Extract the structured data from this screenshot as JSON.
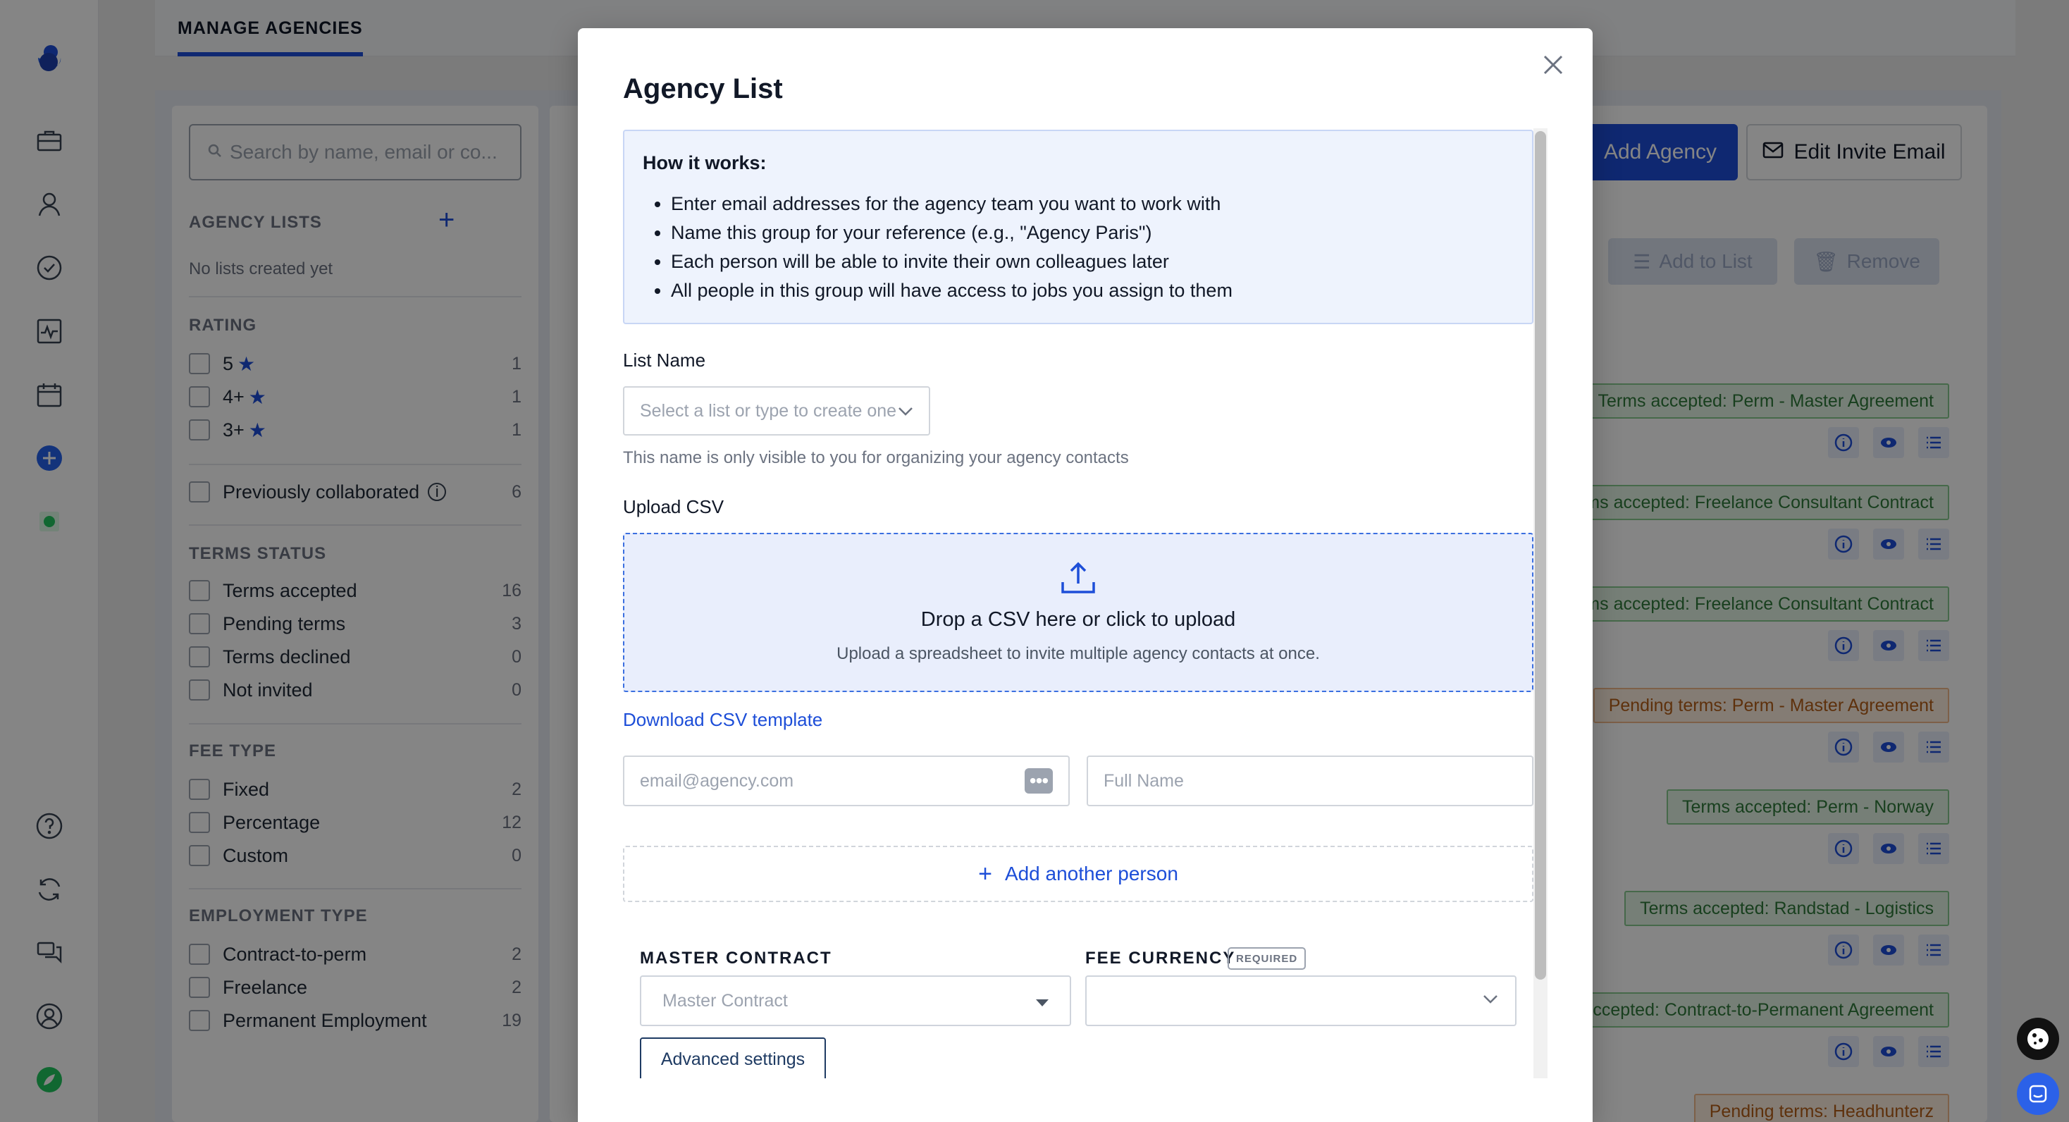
{
  "rail": {
    "icons": [
      "logo-icon",
      "briefcase-icon",
      "person-icon",
      "check-circle-icon",
      "activity-icon",
      "calendar-icon",
      "plus-circle-icon",
      "app-icon",
      "help-icon",
      "sync-icon",
      "chat-icon",
      "account-icon",
      "leaf-icon"
    ]
  },
  "background": {
    "tab_label": "MANAGE AGENCIES",
    "search_placeholder": "Search by name, email or co...",
    "agency_lists_heading": "AGENCY LISTS",
    "no_lists": "No lists created yet",
    "rating_heading": "RATING",
    "rating": [
      {
        "label": "5",
        "count": "1"
      },
      {
        "label": "4+",
        "count": "1"
      },
      {
        "label": "3+",
        "count": "1"
      }
    ],
    "previously_collaborated": {
      "label": "Previously collaborated",
      "count": "6"
    },
    "terms_heading": "TERMS STATUS",
    "terms": [
      {
        "label": "Terms accepted",
        "count": "16"
      },
      {
        "label": "Pending terms",
        "count": "3"
      },
      {
        "label": "Terms declined",
        "count": "0"
      },
      {
        "label": "Not invited",
        "count": "0"
      }
    ],
    "fee_heading": "FEE TYPE",
    "fee": [
      {
        "label": "Fixed",
        "count": "2"
      },
      {
        "label": "Percentage",
        "count": "12"
      },
      {
        "label": "Custom",
        "count": "0"
      }
    ],
    "employment_heading": "EMPLOYMENT TYPE",
    "employment": [
      {
        "label": "Contract-to-perm",
        "count": "2"
      },
      {
        "label": "Freelance",
        "count": "2"
      },
      {
        "label": "Permanent Employment",
        "count": "19"
      }
    ],
    "add_agency": "Add Agency",
    "edit_invite_email": "Edit Invite Email",
    "add_to_list": "Add to List",
    "remove": "Remove",
    "badges": [
      {
        "text": "Terms accepted: Perm - Master Agreement",
        "status": "accepted"
      },
      {
        "text": "rms accepted: Freelance Consultant Contract",
        "status": "accepted"
      },
      {
        "text": "rms accepted: Freelance Consultant Contract",
        "status": "accepted"
      },
      {
        "text": "Pending terms: Perm - Master Agreement",
        "status": "pending"
      },
      {
        "text": "Terms accepted: Perm - Norway",
        "status": "accepted"
      },
      {
        "text": "Terms accepted: Randstad - Logistics",
        "status": "accepted"
      },
      {
        "text": "ccepted: Contract-to-Permanent Agreement",
        "status": "accepted"
      },
      {
        "text": "Pending terms: Headhunterz",
        "status": "pending"
      }
    ]
  },
  "modal": {
    "title": "Agency List",
    "how_title": "How it works:",
    "how_items": [
      "Enter email addresses for the agency team you want to work with",
      "Name this group for your reference (e.g., \"Agency Paris\")",
      "Each person will be able to invite their own colleagues later",
      "All people in this group will have access to jobs you assign to them"
    ],
    "list_name_label": "List Name",
    "list_name_placeholder": "Select a list or type to create one",
    "list_name_help": "This name is only visible to you for organizing your agency contacts",
    "upload_label": "Upload CSV",
    "dropzone_title": "Drop a CSV here or click to upload",
    "dropzone_sub": "Upload a spreadsheet to invite multiple agency contacts at once.",
    "download_template": "Download CSV template",
    "email_placeholder": "email@agency.com",
    "fullname_placeholder": "Full Name",
    "add_another": "Add another person",
    "master_contract_label": "MASTER CONTRACT",
    "fee_currency_label": "FEE CURRENCY",
    "required_badge": "REQUIRED",
    "master_contract_placeholder": "Master Contract",
    "fee_currency_value": "",
    "advanced_settings": "Advanced settings"
  },
  "colors": {
    "accent": "#1d4ed8",
    "accepted_badge": "#e3f4e5",
    "pending_badge": "#fdeedf",
    "info_box": "#eef3fd"
  }
}
